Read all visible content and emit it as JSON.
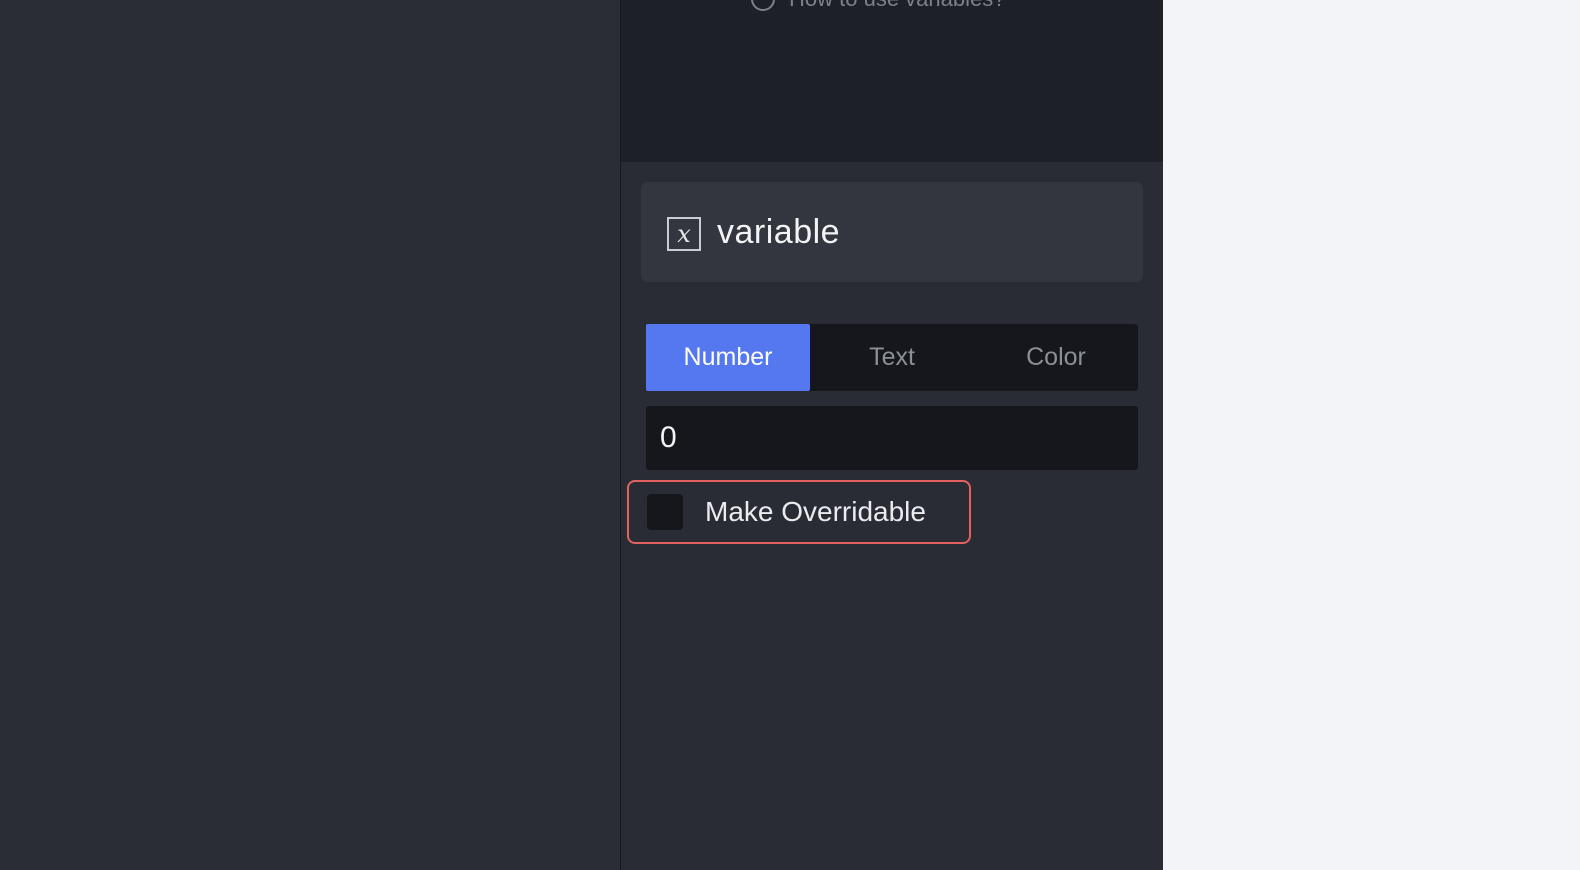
{
  "help": {
    "link_text": "How to use variables?"
  },
  "variable": {
    "icon": "variable-x-icon",
    "name": "variable"
  },
  "type_tabs": [
    {
      "label": "Number",
      "active": true
    },
    {
      "label": "Text",
      "active": false
    },
    {
      "label": "Color",
      "active": false
    }
  ],
  "value": {
    "current": "0"
  },
  "override": {
    "label": "Make Overridable",
    "checked": false
  },
  "colors": {
    "accent": "#5578f1",
    "highlight": "#e3625f"
  }
}
